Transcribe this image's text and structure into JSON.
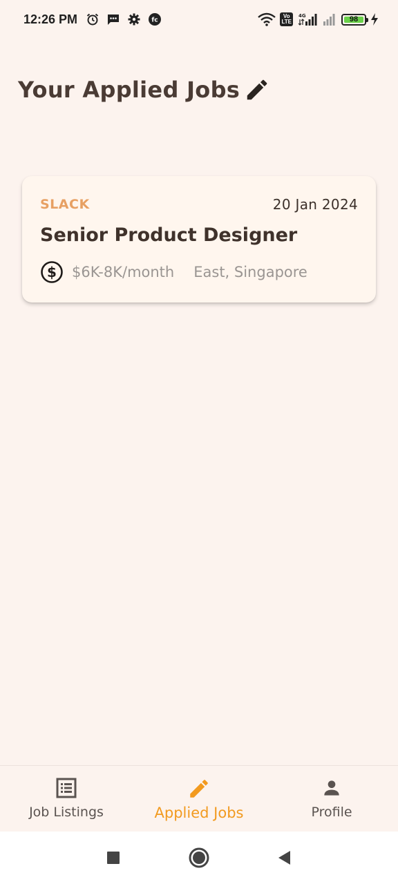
{
  "status_bar": {
    "time": "12:26 PM",
    "network": "4G",
    "battery_level": "98",
    "icons": [
      "alarm-icon",
      "message-icon",
      "settings-icon",
      "fc-app-icon",
      "wifi-icon",
      "volte-icon",
      "signal-icon",
      "signal-icon",
      "battery-icon",
      "charging-icon"
    ]
  },
  "header": {
    "title": "Your Applied Jobs",
    "icon": "pencil-icon"
  },
  "applied_jobs": [
    {
      "company": "SLACK",
      "date": "20 Jan 2024",
      "title": "Senior Product Designer",
      "salary": "$6K-8K/month",
      "location": "East, Singapore",
      "salary_icon": "dollar-circle-icon"
    }
  ],
  "bottom_nav": {
    "items": [
      {
        "label": "Job Listings",
        "icon": "list-icon",
        "active": false
      },
      {
        "label": "Applied Jobs",
        "icon": "pencil-icon",
        "active": true
      },
      {
        "label": "Profile",
        "icon": "person-icon",
        "active": false
      }
    ]
  },
  "system_nav": {
    "buttons": [
      "recents-button",
      "home-button",
      "back-button"
    ]
  },
  "colors": {
    "background": "#fcf3ee",
    "card": "#fff6ee",
    "company_accent": "#e7a063",
    "active_nav": "#f29a1f",
    "text_dark": "#3f322b",
    "text_muted": "#9a9592"
  }
}
